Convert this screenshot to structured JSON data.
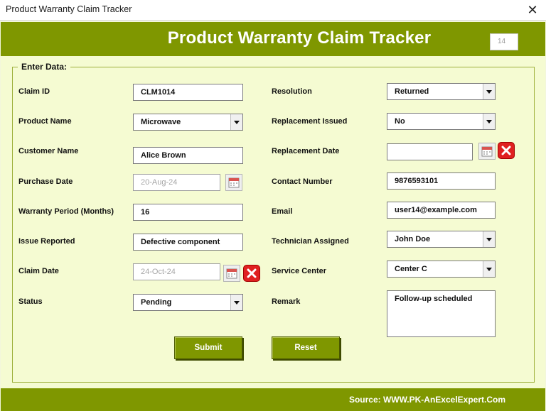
{
  "window": {
    "title": "Product Warranty Claim Tracker",
    "close_glyph": "✕"
  },
  "header": {
    "title": "Product Warranty Claim Tracker",
    "counter": "14"
  },
  "form": {
    "legend": "Enter Data:",
    "left": [
      {
        "label": "Claim ID",
        "value": "CLM1014",
        "type": "text"
      },
      {
        "label": "Product Name",
        "value": "Microwave",
        "type": "combo"
      },
      {
        "label": "Customer Name",
        "value": "Alice Brown",
        "type": "text"
      },
      {
        "label": "Purchase Date",
        "value": "20-Aug-24",
        "type": "date"
      },
      {
        "label": "Warranty Period (Months)",
        "value": "16",
        "type": "text"
      },
      {
        "label": "Issue Reported",
        "value": "Defective component",
        "type": "text"
      },
      {
        "label": "Claim Date",
        "value": "24-Oct-24",
        "type": "date"
      },
      {
        "label": "Status",
        "value": "Pending",
        "type": "combo"
      }
    ],
    "right": [
      {
        "label": "Resolution",
        "value": "Returned",
        "type": "combo"
      },
      {
        "label": "Replacement Issued",
        "value": "No",
        "type": "combo"
      },
      {
        "label": "Replacement Date",
        "value": "",
        "type": "date"
      },
      {
        "label": "Contact Number",
        "value": "9876593101",
        "type": "text"
      },
      {
        "label": "Email",
        "value": "user14@example.com",
        "type": "text"
      },
      {
        "label": "Technician Assigned",
        "value": "John Doe",
        "type": "combo"
      },
      {
        "label": "Service Center",
        "value": "Center C",
        "type": "combo"
      },
      {
        "label": "Remark",
        "value": "Follow-up scheduled",
        "type": "multiline"
      }
    ]
  },
  "buttons": {
    "submit": "Submit",
    "reset": "Reset"
  },
  "footer": {
    "source": "Source: WWW.PK-AnExcelExpert.Com"
  },
  "colors": {
    "accent": "#7f9700",
    "panel": "#f5fbd2",
    "clear": "#e02020"
  },
  "icons": {
    "calendar": "calendar-icon",
    "clear": "clear-x-icon",
    "dropdown": "chevron-down-icon"
  }
}
